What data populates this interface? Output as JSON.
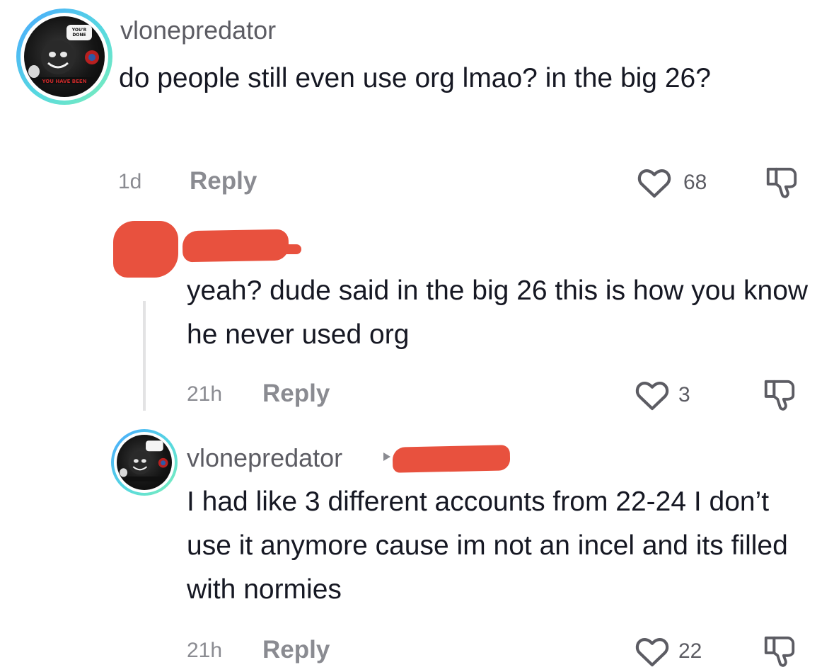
{
  "comment1": {
    "username": "vlonepredator",
    "text": "do people still even use org lmao? in the big 26?",
    "time": "1d",
    "reply_label": "Reply",
    "likes": "68"
  },
  "comment2": {
    "text": "yeah? dude said in the big 26 this is how you know he never used org",
    "time": "21h",
    "reply_label": "Reply",
    "likes": "3"
  },
  "comment3": {
    "username": "vlonepredator",
    "text": "I had like 3 different accounts from 22-24 I don’t use it anymore cause im not an incel and its filled with normies",
    "time": "21h",
    "reply_label": "Reply",
    "likes": "22"
  },
  "avatar_text": {
    "bubble": "YOU'RE DONE BLUD",
    "banner": "YOU HAVE BEEN HACKED BY"
  },
  "icons": {
    "like": "heart-outline-icon",
    "dislike": "thumbs-down-outline-icon",
    "reply_arrow": "reply-to-arrow-icon"
  },
  "colors": {
    "redaction": "#e8513e",
    "avatar_ring_start": "#4aa8ff",
    "avatar_ring_end": "#7ef0b8"
  }
}
